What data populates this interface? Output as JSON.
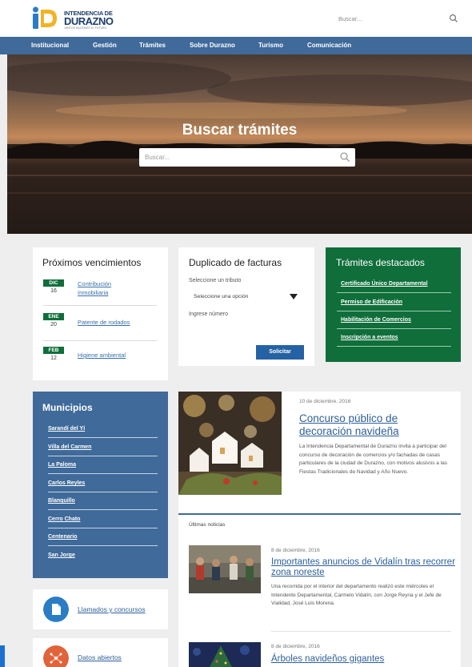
{
  "header": {
    "logo": {
      "line1": "INTENDENCIA DE",
      "line2": "DURAZNO",
      "tagline": "JUNTOS HACEMOS EL FUTURO",
      "colors": {
        "yellow": "#f4b324",
        "blue": "#2a7dc4",
        "navy": "#1e3d6b"
      }
    },
    "search_placeholder": "Buscar...",
    "search_icon": "search-icon"
  },
  "nav": {
    "items": [
      "Institucional",
      "Gestión",
      "Trámites",
      "Sobre Durazno",
      "Turismo",
      "Comunicación"
    ]
  },
  "hero": {
    "title": "Buscar trámites",
    "search_placeholder": "Buscar...",
    "search_icon": "search-icon"
  },
  "vencimientos": {
    "title": "Próximos vencimientos",
    "items": [
      {
        "month": "DIC",
        "day": "16",
        "label": "Contribución Inmobiliaria"
      },
      {
        "month": "ENE",
        "day": "20",
        "label": "Patente de rodados"
      },
      {
        "month": "FEB",
        "day": "12",
        "label": "Higiene ambiental"
      }
    ],
    "accent": "#0f6e3a"
  },
  "duplicado": {
    "title": "Duplicado de facturas",
    "tributo_label": "Seleccione un tributo",
    "select_value": "Seleccione una opción",
    "numero_label": "Ingrese número",
    "button_label": "Solicitar",
    "button_color": "#2562a3"
  },
  "destacados": {
    "title": "Trámites destacados",
    "links": [
      "Certificado Único Departamental",
      "Permiso de Edificación",
      "Habilitación de Comercios",
      "Inscripción a eventos"
    ],
    "color": "#0f6e3a"
  },
  "municipios": {
    "title": "Municipios",
    "links": [
      "Sarandí del Yí",
      "Villa del Carmen",
      "La Paloma",
      "Carlos Reyles",
      "Blanquillo",
      "Cerro Chato",
      "Centenario",
      "San Jorge"
    ],
    "color": "#3f6a9a"
  },
  "quick_links": [
    {
      "label": "Llamados y concursos",
      "icon": "document-icon",
      "color": "#2a7dc4"
    },
    {
      "label": "Datos abiertos",
      "icon": "data-icon",
      "color": "#e0633a"
    }
  ],
  "featured_news": {
    "date": "10 de diciembre, 2016",
    "title": "Concurso público de decoración navideña",
    "body": "La Intendencia Departamental de Durazno invita a participar del concurso de decoración de comercios y/o fachadas de casas particulares de la ciudad de Durazno, con motivos alusivos a las Fiestas Tradicionales de Navidad y Año Nuevo."
  },
  "latest_news": {
    "heading": "Últimas noticias",
    "items": [
      {
        "date": "8 de diciembre, 2016",
        "title": "Importantes anuncios de Vidalín tras recorrer zona noreste",
        "body": "Una recorrida por el interior del departamento realizó este miércoles el Intendente Departamental, Carmelo Vidalín, con Jorge Reyna y el Jefe de Vialidad, José Luis Morena."
      },
      {
        "date": "8 de diciembre, 2016",
        "title": "Árboles navideños gigantes",
        "body": ""
      }
    ]
  }
}
